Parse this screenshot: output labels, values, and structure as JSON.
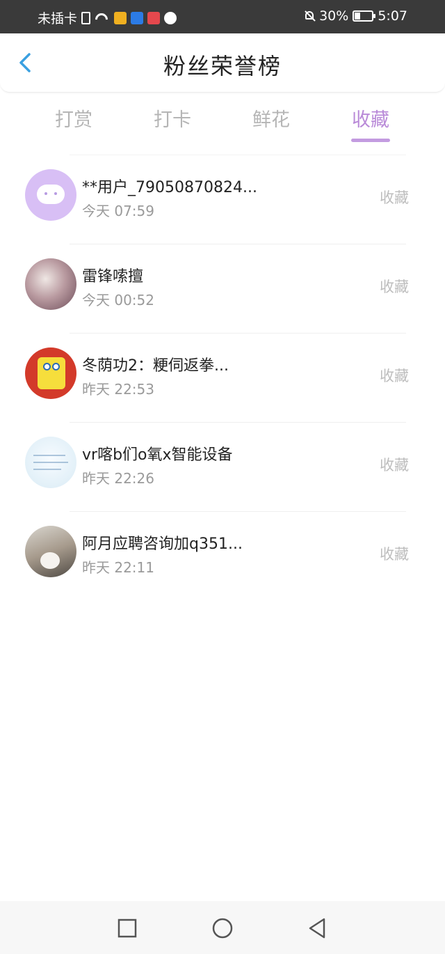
{
  "status_bar": {
    "carrier": "未插卡",
    "battery_percent": "30%",
    "time": "5:07",
    "icons": [
      "sim-icon",
      "wifi-icon",
      "weibo-icon",
      "app-icon",
      "app-icon",
      "app-icon",
      "mute-bell-icon",
      "battery-icon"
    ]
  },
  "header": {
    "title": "粉丝荣誉榜",
    "back_icon": "chevron-left-icon"
  },
  "tabs": [
    {
      "label": "打赏",
      "active": false
    },
    {
      "label": "打卡",
      "active": false
    },
    {
      "label": "鲜花",
      "active": false
    },
    {
      "label": "收藏",
      "active": true
    }
  ],
  "list": [
    {
      "name": "**用户_79050870824...",
      "time": "今天 07:59",
      "action": "收藏"
    },
    {
      "name": "雷锋嗦擅",
      "time": "今天 00:52",
      "action": "收藏"
    },
    {
      "name": "冬荫功2：粳伺返拳...",
      "time": "昨天 22:53",
      "action": "收藏"
    },
    {
      "name": "vr喀b们o氧x智能设备",
      "time": "昨天 22:26",
      "action": "收藏"
    },
    {
      "name": "阿月应聘咨询加q351...",
      "time": "昨天 22:11",
      "action": "收藏"
    }
  ],
  "colors": {
    "accent": "#b98ad8",
    "back_arrow": "#3aa0e0",
    "inactive_tab": "#b5b5b5",
    "muted_text": "#9a9a9a"
  },
  "nav_bar": [
    "square-icon",
    "circle-icon",
    "triangle-back-icon"
  ]
}
